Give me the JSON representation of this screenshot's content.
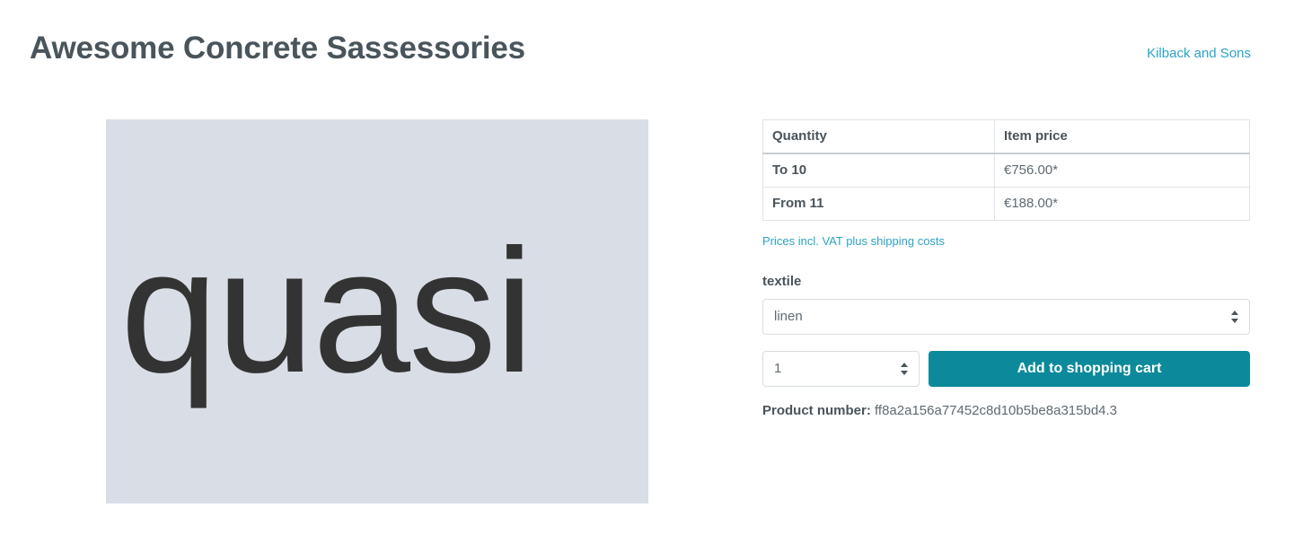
{
  "header": {
    "product_title": "Awesome Concrete Sassessories",
    "manufacturer_link": "Kilback and Sons"
  },
  "gallery": {
    "placeholder_text": "quasi",
    "background_color": "#d9dde5",
    "text_color": "#333333"
  },
  "buy_widget": {
    "price_table": {
      "columns": [
        "Quantity",
        "Item price"
      ],
      "rows": [
        {
          "quantity": "To 10",
          "price": "€756.00*"
        },
        {
          "quantity": "From 11",
          "price": "€188.00*"
        }
      ]
    },
    "tax_link": "Prices incl. VAT plus shipping costs",
    "variant": {
      "label": "textile",
      "selected": "linen",
      "options": [
        "linen"
      ]
    },
    "quantity": {
      "selected": "1",
      "options": [
        "1"
      ]
    },
    "add_to_cart_label": "Add to shopping cart",
    "add_to_cart_color": "#0c8a9b",
    "product_number_label": "Product number:",
    "product_number_value": "ff8a2a156a77452c8d10b5be8a315bd4.3"
  }
}
